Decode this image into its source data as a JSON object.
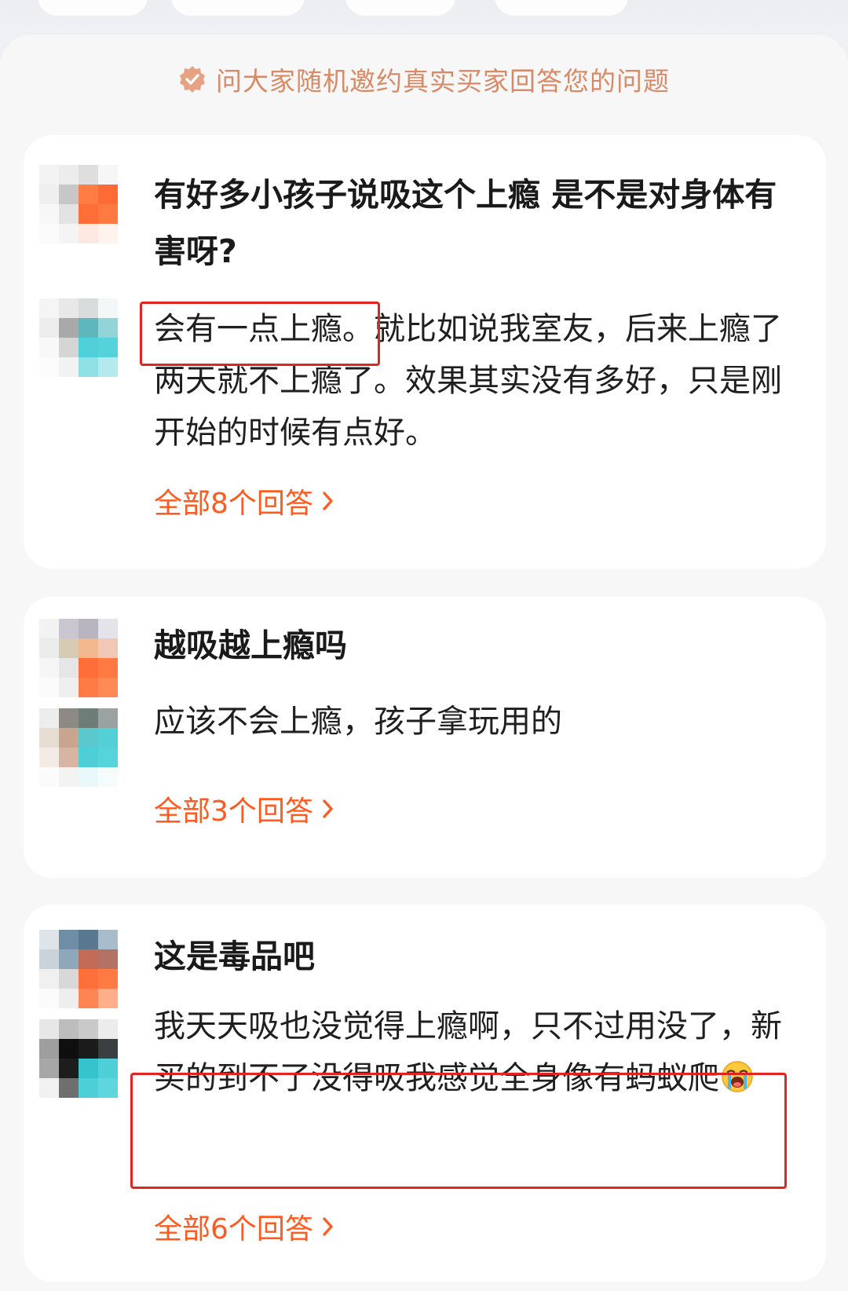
{
  "banner": {
    "icon": "verified-badge-icon",
    "text": "问大家随机邀约真实买家回答您的问题"
  },
  "cards": [
    {
      "question": "有好多小孩子说吸这个上瘾 是不是对身体有害呀?",
      "answer_highlight": "会有一点上瘾。",
      "answer_rest": "就比如说我室友，后来上瘾了两天就不上瘾了。效果其实没有多好，只是刚开始的时候有点好。",
      "all_answers": "全部8个回答"
    },
    {
      "question": "越吸越上瘾吗",
      "answer": "应该不会上瘾，孩子拿玩用的",
      "all_answers": "全部3个回答"
    },
    {
      "question": "这是毒品吧",
      "answer": "我天天吸也没觉得上瘾啊，只不过用没了，新买的到不了没得吸我感觉全身像有蚂蚁爬",
      "answer_emoji": "crying-face-emoji",
      "all_answers": "全部6个回答"
    }
  ],
  "colors": {
    "accent": "#ff5a1f",
    "banner_text": "#d88a66",
    "highlight_box": "#e0241f"
  }
}
